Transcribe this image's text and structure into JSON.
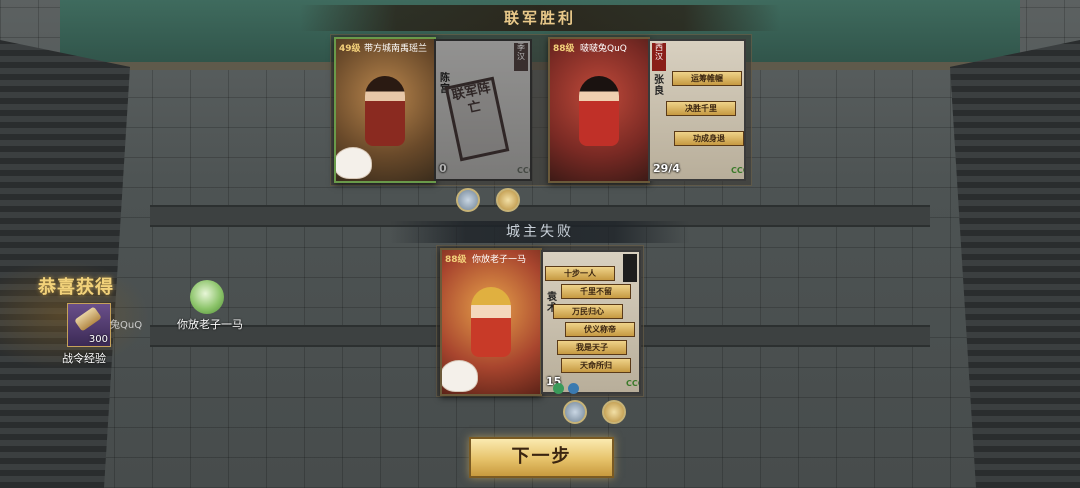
{
  "top_banner": "联军胜利",
  "mid_banner": "城主失败",
  "top_team": {
    "left": {
      "level": "49级",
      "player": "带方城南禹瑶兰",
      "general": {
        "faction": "季汉",
        "name": "陈宫",
        "hp": "0",
        "stamp": "联军阵亡",
        "marks": "CCC"
      }
    },
    "right": {
      "level": "88级",
      "player": "啵啵兔QuQ",
      "general": {
        "faction": "西汉",
        "name": "张良",
        "hp": "29/4",
        "marks": "CCC",
        "plaques": [
          "运筹帷幄",
          "决胜千里",
          "功成身退"
        ]
      }
    }
  },
  "mid_team": {
    "level": "88级",
    "player": "你放老子一马",
    "general": {
      "name": "袁术",
      "hp": "15",
      "marks": "CCC",
      "plaques": [
        "十步一人",
        "千里不留",
        "万民归心",
        "伏义称帝",
        "我是天子",
        "天命所归"
      ]
    }
  },
  "reward": {
    "title": "恭喜获得",
    "item_label": "战令经验",
    "count": "300",
    "ghost_name": "兔QuQ"
  },
  "player_label": "你放老子一马",
  "next_button": "下一步",
  "colors": {
    "gold": "#e6c26a",
    "banner_text": "#e9c98a",
    "red_stamp": "#a01e18"
  }
}
